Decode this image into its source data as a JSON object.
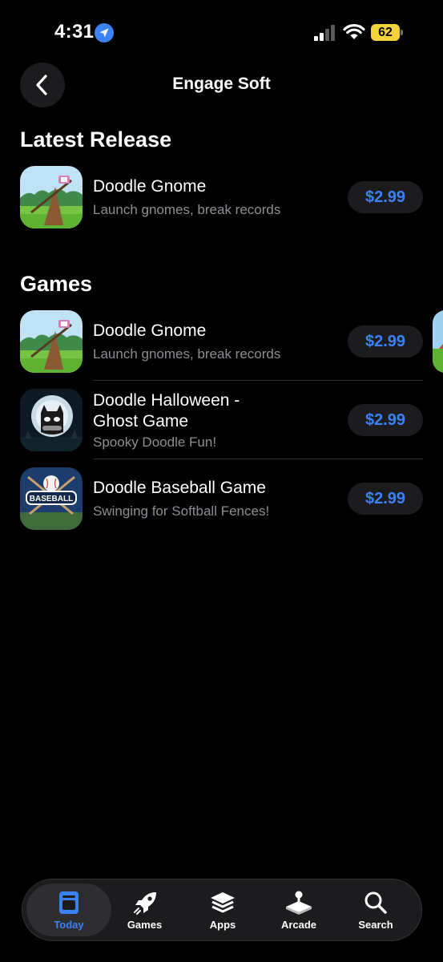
{
  "status": {
    "time": "4:31",
    "battery": "62"
  },
  "nav": {
    "title": "Engage Soft"
  },
  "sections": {
    "latest": {
      "title": "Latest Release",
      "items": [
        {
          "name": "Doodle Gnome",
          "subtitle": "Launch gnomes, break records",
          "price": "$2.99",
          "icon": "gnome-icon"
        }
      ]
    },
    "games": {
      "title": "Games",
      "items": [
        {
          "name": "Doodle Gnome",
          "subtitle": "Launch gnomes, break records",
          "price": "$2.99",
          "icon": "gnome-icon"
        },
        {
          "name_line1": "Doodle Halloween -",
          "name_line2": "Ghost Game",
          "subtitle": "Spooky Doodle Fun!",
          "price": "$2.99",
          "icon": "halloween-icon"
        },
        {
          "name": "Doodle Baseball Game",
          "subtitle": "Swinging for Softball Fences!",
          "price": "$2.99",
          "icon": "baseball-icon",
          "icon_text": "BASEBALL"
        }
      ]
    }
  },
  "tabs": [
    {
      "label": "Today",
      "icon": "today-icon",
      "active": true
    },
    {
      "label": "Games",
      "icon": "rocket-icon",
      "active": false
    },
    {
      "label": "Apps",
      "icon": "layers-icon",
      "active": false
    },
    {
      "label": "Arcade",
      "icon": "joystick-icon",
      "active": false
    },
    {
      "label": "Search",
      "icon": "search-icon",
      "active": false
    }
  ],
  "colors": {
    "accent": "#3b82f6",
    "battery": "#f4d33a",
    "background": "#000000",
    "subtitle": "#8d8d93"
  }
}
